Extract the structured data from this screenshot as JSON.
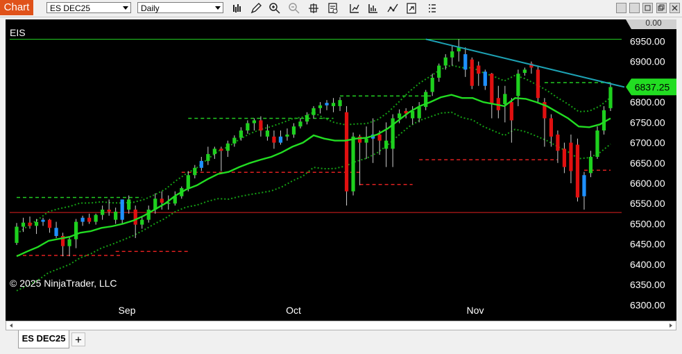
{
  "toolbar": {
    "chart_label": "Chart",
    "instrument": "ES DEC25",
    "interval": "Daily",
    "icons": [
      "bar-type-icon",
      "drawing-pencil-icon",
      "zoom-in-icon",
      "zoom-out-icon",
      "crosshair-icon",
      "data-box-icon",
      "indicators-icon",
      "strategies-icon",
      "drawing-tools-icon",
      "properties-icon",
      "more-icon"
    ],
    "window_buttons": [
      "pin-icon",
      "minimize-icon",
      "maximize-icon",
      "close-icon"
    ]
  },
  "chart": {
    "symbol": "EIS",
    "copyright": "© 2025 NinjaTrader, LLC",
    "top_label": "0.00",
    "current_price_label": "6837.25",
    "price_ticks": [
      "6950.00",
      "6900.00",
      "6850.00",
      "6800.00",
      "6750.00",
      "6700.00",
      "6650.00",
      "6600.00",
      "6550.00",
      "6500.00",
      "6450.00",
      "6400.00",
      "6350.00",
      "6300.00"
    ],
    "date_ticks": [
      "Sep",
      "Oct",
      "Nov"
    ],
    "colors": {
      "up": "#1ed01e",
      "down": "#e01010",
      "neutral": "#1e90ff",
      "ma": "#22dd22",
      "band": "#15a015",
      "trend": "#1da2b4",
      "green_level": "#22cc22",
      "red_level": "#e02020"
    }
  },
  "tabs": {
    "active": "ES DEC25",
    "add": "+"
  },
  "chart_data": {
    "type": "candlestick",
    "price_range": [
      6275,
      6990
    ],
    "price_tick_values": [
      6950,
      6900,
      6850,
      6800,
      6750,
      6700,
      6650,
      6600,
      6550,
      6500,
      6450,
      6400,
      6350,
      6300
    ],
    "candles": [
      [
        6453,
        6502,
        6448,
        6493,
        "up"
      ],
      [
        6493,
        6515,
        6480,
        6503,
        "up"
      ],
      [
        6503,
        6518,
        6488,
        6495,
        "down"
      ],
      [
        6495,
        6512,
        6475,
        6505,
        "up"
      ],
      [
        6505,
        6515,
        6495,
        6510,
        "neutral"
      ],
      [
        6510,
        6512,
        6478,
        6490,
        "down"
      ],
      [
        6490,
        6505,
        6465,
        6470,
        "neutral"
      ],
      [
        6470,
        6478,
        6420,
        6445,
        "down"
      ],
      [
        6445,
        6470,
        6420,
        6462,
        "up"
      ],
      [
        6462,
        6512,
        6440,
        6505,
        "up"
      ],
      [
        6505,
        6520,
        6495,
        6515,
        "neutral"
      ],
      [
        6515,
        6525,
        6500,
        6505,
        "down"
      ],
      [
        6505,
        6525,
        6498,
        6522,
        "up"
      ],
      [
        6522,
        6545,
        6510,
        6535,
        "up"
      ],
      [
        6535,
        6560,
        6520,
        6530,
        "down"
      ],
      [
        6530,
        6540,
        6500,
        6510,
        "up"
      ],
      [
        6510,
        6560,
        6500,
        6560,
        "neutral"
      ],
      [
        6560,
        6570,
        6525,
        6535,
        "up"
      ],
      [
        6535,
        6545,
        6465,
        6498,
        "down"
      ],
      [
        6498,
        6518,
        6488,
        6510,
        "up"
      ],
      [
        6510,
        6545,
        6503,
        6535,
        "up"
      ],
      [
        6535,
        6575,
        6525,
        6562,
        "up"
      ],
      [
        6562,
        6580,
        6535,
        6552,
        "down"
      ],
      [
        6552,
        6570,
        6535,
        6550,
        "up"
      ],
      [
        6550,
        6580,
        6545,
        6568,
        "up"
      ],
      [
        6568,
        6592,
        6562,
        6588,
        "up"
      ],
      [
        6588,
        6630,
        6580,
        6620,
        "up"
      ],
      [
        6620,
        6645,
        6612,
        6638,
        "up"
      ],
      [
        6638,
        6665,
        6630,
        6655,
        "neutral"
      ],
      [
        6655,
        6690,
        6645,
        6672,
        "up"
      ],
      [
        6672,
        6690,
        6660,
        6685,
        "up"
      ],
      [
        6685,
        6690,
        6630,
        6680,
        "down"
      ],
      [
        6680,
        6705,
        6665,
        6698,
        "up"
      ],
      [
        6698,
        6718,
        6690,
        6712,
        "up"
      ],
      [
        6712,
        6738,
        6705,
        6730,
        "up"
      ],
      [
        6730,
        6755,
        6722,
        6748,
        "up"
      ],
      [
        6748,
        6760,
        6730,
        6755,
        "up"
      ],
      [
        6755,
        6765,
        6715,
        6730,
        "down"
      ],
      [
        6730,
        6745,
        6705,
        6715,
        "up"
      ],
      [
        6715,
        6730,
        6685,
        6700,
        "down"
      ],
      [
        6700,
        6730,
        6695,
        6715,
        "neutral"
      ],
      [
        6715,
        6735,
        6705,
        6720,
        "up"
      ],
      [
        6720,
        6748,
        6712,
        6740,
        "up"
      ],
      [
        6740,
        6760,
        6735,
        6752,
        "up"
      ],
      [
        6752,
        6775,
        6745,
        6768,
        "up"
      ],
      [
        6768,
        6790,
        6760,
        6785,
        "up"
      ],
      [
        6785,
        6800,
        6772,
        6792,
        "up"
      ],
      [
        6792,
        6805,
        6780,
        6798,
        "neutral"
      ],
      [
        6798,
        6810,
        6775,
        6790,
        "up"
      ],
      [
        6790,
        6812,
        6778,
        6805,
        "up"
      ],
      [
        6775,
        6790,
        6545,
        6580,
        "down"
      ],
      [
        6580,
        6725,
        6570,
        6715,
        "up"
      ],
      [
        6715,
        6720,
        6595,
        6700,
        "down"
      ],
      [
        6700,
        6740,
        6660,
        6710,
        "up"
      ],
      [
        6710,
        6760,
        6650,
        6720,
        "neutral"
      ],
      [
        6720,
        6730,
        6670,
        6705,
        "down"
      ],
      [
        6705,
        6750,
        6640,
        6685,
        "up"
      ],
      [
        6685,
        6770,
        6640,
        6760,
        "up"
      ],
      [
        6760,
        6782,
        6748,
        6772,
        "up"
      ],
      [
        6772,
        6785,
        6760,
        6778,
        "down"
      ],
      [
        6778,
        6790,
        6745,
        6760,
        "up"
      ],
      [
        6760,
        6800,
        6750,
        6788,
        "up"
      ],
      [
        6788,
        6830,
        6780,
        6825,
        "up"
      ],
      [
        6825,
        6870,
        6815,
        6860,
        "up"
      ],
      [
        6860,
        6895,
        6850,
        6890,
        "up"
      ],
      [
        6890,
        6918,
        6880,
        6910,
        "up"
      ],
      [
        6910,
        6940,
        6890,
        6925,
        "up"
      ],
      [
        6925,
        6955,
        6900,
        6935,
        "up"
      ],
      [
        6918,
        6935,
        6862,
        6880,
        "neutral"
      ],
      [
        6905,
        6910,
        6832,
        6840,
        "down"
      ],
      [
        6890,
        6900,
        6840,
        6870,
        "down"
      ],
      [
        6875,
        6880,
        6830,
        6840,
        "neutral"
      ],
      [
        6870,
        6872,
        6760,
        6795,
        "down"
      ],
      [
        6810,
        6840,
        6760,
        6780,
        "down"
      ],
      [
        6795,
        6840,
        6750,
        6820,
        "up"
      ],
      [
        6800,
        6810,
        6700,
        6755,
        "down"
      ],
      [
        6815,
        6880,
        6790,
        6870,
        "up"
      ],
      [
        6872,
        6885,
        6865,
        6880,
        "up"
      ],
      [
        6885,
        6900,
        6870,
        6895,
        "down"
      ],
      [
        6880,
        6890,
        6800,
        6810,
        "down"
      ],
      [
        6800,
        6810,
        6690,
        6760,
        "down"
      ],
      [
        6760,
        6770,
        6690,
        6715,
        "down"
      ],
      [
        6720,
        6730,
        6650,
        6680,
        "down"
      ],
      [
        6685,
        6700,
        6625,
        6640,
        "down"
      ],
      [
        6700,
        6720,
        6600,
        6630,
        "down"
      ],
      [
        6695,
        6710,
        6555,
        6565,
        "down"
      ],
      [
        6568,
        6628,
        6535,
        6620,
        "neutral"
      ],
      [
        6625,
        6680,
        6615,
        6665,
        "up"
      ],
      [
        6665,
        6740,
        6660,
        6730,
        "up"
      ],
      [
        6730,
        6790,
        6720,
        6780,
        "up"
      ],
      [
        6785,
        6848,
        6778,
        6837,
        "up"
      ]
    ],
    "moving_average": [
      6420,
      6432,
      6443,
      6458,
      6463,
      6468,
      6478,
      6482,
      6490,
      6494,
      6500,
      6508,
      6520,
      6535,
      6550,
      6570,
      6585,
      6595,
      6610,
      6623,
      6628,
      6640,
      6650,
      6658,
      6665,
      6676,
      6690,
      6700,
      6718,
      6710,
      6705,
      6705,
      6710,
      6712,
      6720,
      6735,
      6755,
      6775,
      6790,
      6800,
      6812,
      6818,
      6810,
      6810,
      6800,
      6795,
      6790,
      6810,
      6808,
      6800,
      6790,
      6775,
      6760,
      6740,
      6738,
      6745,
      6760
    ],
    "horizontal_levels": {
      "green": [
        6955
      ],
      "red": [
        6528
      ]
    },
    "trendline": {
      "from_price": 6955,
      "to_price": 6837
    }
  }
}
